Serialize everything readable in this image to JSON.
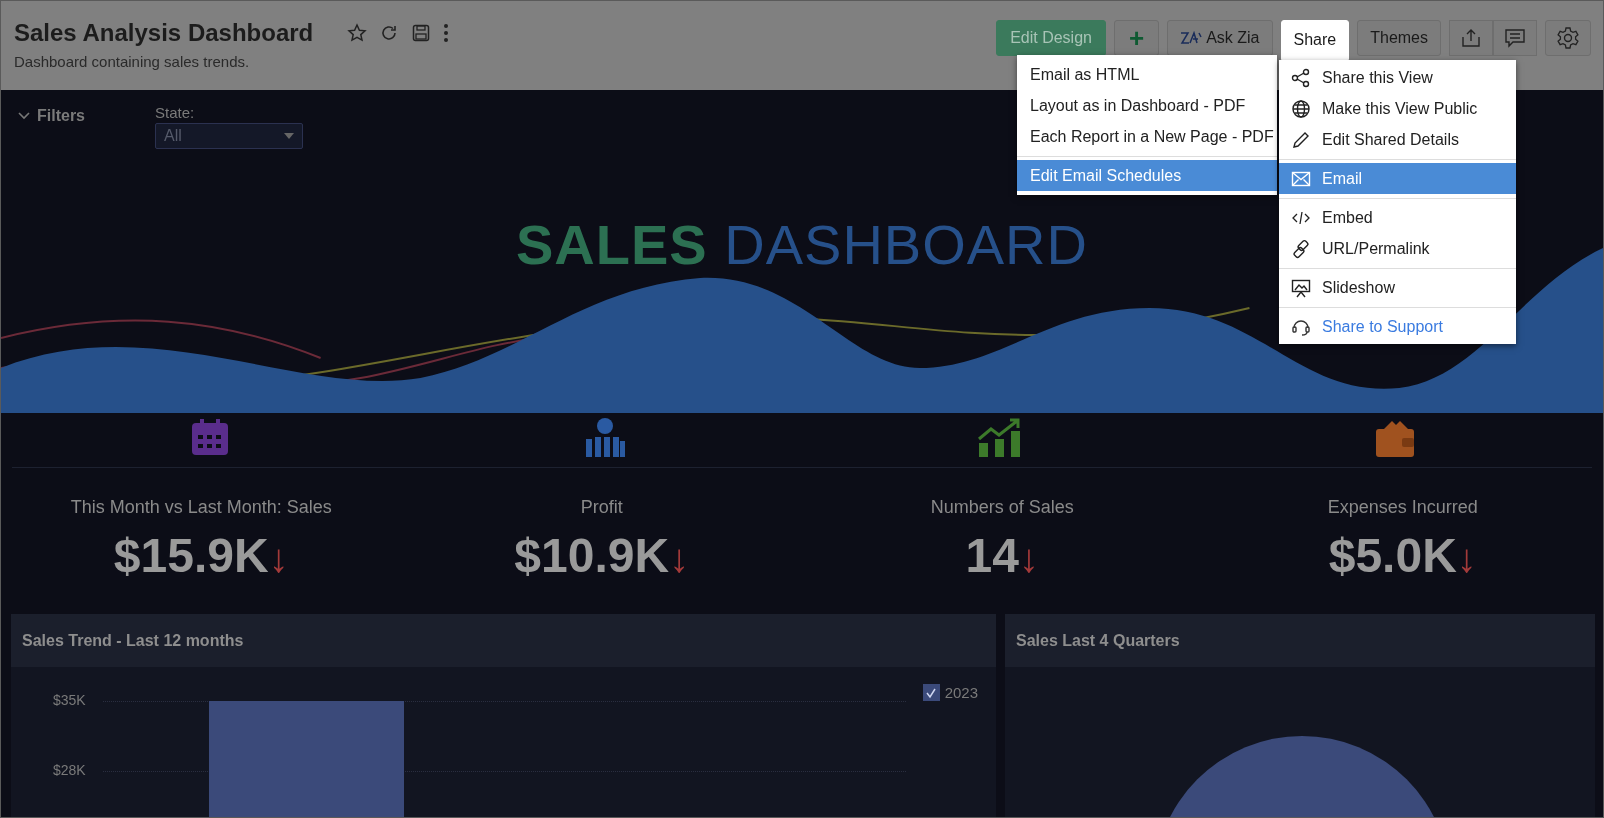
{
  "header": {
    "title": "Sales Analysis Dashboard",
    "subtitle": "Dashboard containing sales trends."
  },
  "toolbar": {
    "buttons": [
      {
        "label": "Edit Design",
        "kind": "primary",
        "selected": false
      },
      {
        "label": "+",
        "kind": "plus",
        "selected": false
      },
      {
        "label": "Ask Zia",
        "kind": "zia",
        "selected": false
      },
      {
        "label": "Share",
        "kind": "plain",
        "selected": true
      },
      {
        "label": "Themes",
        "kind": "plain",
        "selected": false
      }
    ]
  },
  "filters": {
    "label": "Filters",
    "expanded": true,
    "state_label": "State:",
    "state_value": "All"
  },
  "hero": {
    "title_bold": "SALES",
    "title_light": "DASHBOARD"
  },
  "kpis": [
    {
      "kind": "calendar",
      "title": "This Month vs Last Month: Sales",
      "value": "$15.9K",
      "arrow": "↓"
    },
    {
      "kind": "money",
      "title": "Profit",
      "value": "$10.9K",
      "arrow": "↓"
    },
    {
      "kind": "growth",
      "title": "Numbers of Sales",
      "value": "14",
      "arrow": "↓"
    },
    {
      "kind": "wallet",
      "title": "Expenses Incurred",
      "value": "$5.0K",
      "arrow": "↓"
    }
  ],
  "panels": [
    {
      "title": "Sales Trend - Last 12 months",
      "legend": [
        {
          "label": "2023",
          "checked": true
        }
      ],
      "axis_labels": [
        "$35K",
        "$28K"
      ]
    },
    {
      "title": "Sales Last 4 Quarters"
    }
  ],
  "export_menu": {
    "groups": [
      {
        "items": [
          {
            "label": "Email as HTML",
            "selected": false
          },
          {
            "label": "Layout as in Dashboard - PDF",
            "selected": false
          },
          {
            "label": "Each Report in a New Page - PDF",
            "selected": false
          }
        ]
      },
      {
        "items": [
          {
            "label": "Edit Email Schedules",
            "selected": true
          }
        ]
      }
    ]
  },
  "share_menu": {
    "groups": [
      {
        "items": [
          {
            "kind": "share",
            "label": "Share this View",
            "selected": false
          },
          {
            "kind": "globe",
            "label": "Make this View Public",
            "selected": false
          },
          {
            "kind": "pencil",
            "label": "Edit Shared Details",
            "selected": false
          }
        ]
      },
      {
        "items": [
          {
            "kind": "email",
            "label": "Email",
            "selected": true
          }
        ]
      },
      {
        "items": [
          {
            "kind": "embed",
            "label": "Embed",
            "selected": false
          },
          {
            "kind": "link",
            "label": "URL/Permalink",
            "selected": false
          }
        ]
      },
      {
        "items": [
          {
            "kind": "slideshow",
            "label": "Slideshow",
            "selected": false
          }
        ]
      },
      {
        "items": [
          {
            "kind": "support",
            "label": "Share to Support",
            "selected": false
          }
        ]
      }
    ]
  }
}
